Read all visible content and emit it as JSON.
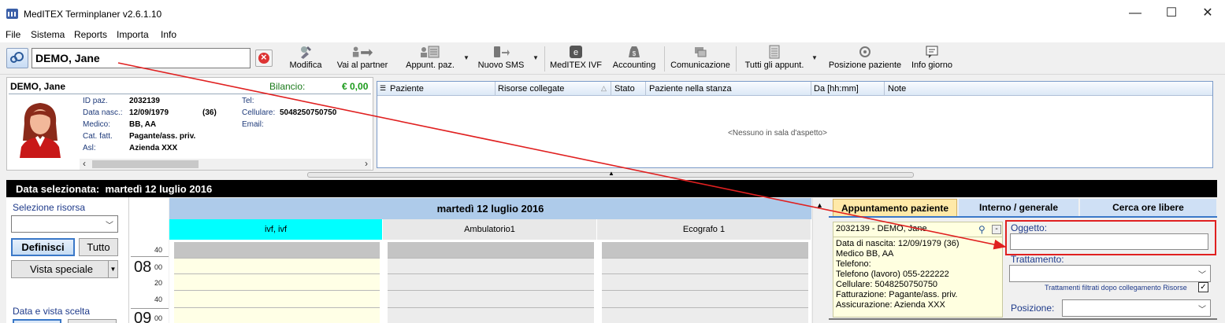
{
  "window": {
    "title": "MedITEX Terminplaner  v2.6.1.10",
    "controls": [
      "—",
      "☐",
      "✕"
    ]
  },
  "menu": [
    "File",
    "Sistema",
    "Reports",
    "Importa",
    "Info"
  ],
  "toolbar": {
    "search_value": "DEMO, Jane",
    "buttons": [
      {
        "label": "Modifica",
        "icon": "edit-icon"
      },
      {
        "label": "Vai al partner",
        "icon": "partner-icon"
      },
      {
        "label": "Appunt. paz.",
        "icon": "appointment-icon"
      },
      {
        "label": "Nuovo SMS",
        "icon": "sms-icon"
      },
      {
        "label": "MedITEX IVF",
        "icon": "ivf-icon"
      },
      {
        "label": "Accounting",
        "icon": "accounting-icon"
      },
      {
        "label": "Comunicazione",
        "icon": "communication-icon"
      },
      {
        "label": "Tutti gli appunt.",
        "icon": "all-appointments-icon"
      },
      {
        "label": "Posizione paziente",
        "icon": "patient-position-icon"
      },
      {
        "label": "Info giorno",
        "icon": "day-info-icon"
      }
    ]
  },
  "patient": {
    "name": "DEMO, Jane",
    "balance_label": "Bilancio:",
    "balance": "€ 0,00",
    "fields": {
      "id_label": "ID paz.",
      "id": "2032139",
      "dob_label": "Data nasc.:",
      "dob": "12/09/1979",
      "age": "(36)",
      "doctor_label": "Medico:",
      "doctor": "BB, AA",
      "billing_label": "Cat. fatt.",
      "billing": "Pagante/ass. priv.",
      "asl_label": "Asl:",
      "asl": "Azienda XXX",
      "tel_label": "Tel:",
      "mobile_label": "Cellulare:",
      "mobile": "5048250750750",
      "email_label": "Email:"
    }
  },
  "waiting_room": {
    "columns": [
      "Paziente",
      "Risorse collegate",
      "Stato",
      "Paziente nella stanza",
      "Da [hh:mm]",
      "Note"
    ],
    "empty_text": "<Nessuno in sala d'aspetto>"
  },
  "date_bar": {
    "label": "Data selezionata:",
    "value": "martedì 12 luglio 2016"
  },
  "sidebar": {
    "resource_label": "Selezione risorsa",
    "define_button": "Definisci",
    "all_button": "Tutto",
    "special_view_button": "Vista speciale",
    "date_view_label": "Data e vista scelta"
  },
  "times": {
    "minutes": [
      "40",
      "00",
      "20",
      "40",
      "00"
    ],
    "hours": [
      "08",
      "09"
    ]
  },
  "calendar": {
    "day_header": "martedì 12 luglio 2016",
    "resources": [
      {
        "name": "ivf, ivf",
        "color": "#00ffff"
      },
      {
        "name": "Ambulatorio1",
        "color": "#e8e8e8"
      },
      {
        "name": "Ecografo 1",
        "color": "#e8e8e8"
      }
    ]
  },
  "right_panel": {
    "tabs": [
      "Appuntamento paziente",
      "Interno / generale",
      "Cerca ore libere"
    ],
    "card": {
      "header": "2032139 - DEMO, Jane",
      "lines": [
        "Data di nascita: 12/09/1979 (36)",
        "Medico BB, AA",
        "Telefono:",
        "Telefono (lavoro) 055-222222",
        "Cellulare: 5048250750750",
        "Fatturazione: Pagante/ass. priv.",
        "Assicurazione: Azienda XXX"
      ]
    },
    "oggetto_label": "Oggetto:",
    "trattamento_label": "Trattamento:",
    "filter_note": "Trattamenti filtrati dopo collegamento Risorse",
    "filter_checked": "✓",
    "posizione_label": "Posizione:"
  },
  "colors": {
    "accent": "#3a78c8",
    "annotation_red": "#e02020",
    "ivf_column": "#00ffff",
    "ivf_slot_bg": "#ffffe6",
    "balance_green": "#1a9a1a"
  }
}
